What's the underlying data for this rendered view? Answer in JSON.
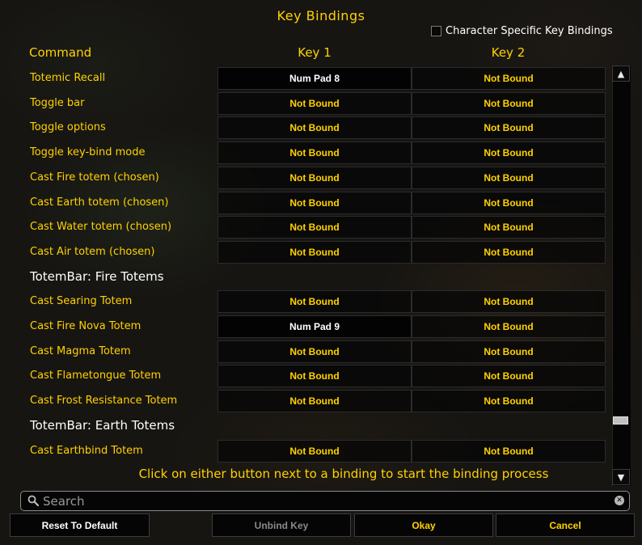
{
  "window": {
    "title": "Key Bindings",
    "character_specific_label": "Character Specific Key Bindings",
    "character_specific_checked": false
  },
  "columns": {
    "command": "Command",
    "key1": "Key 1",
    "key2": "Key 2"
  },
  "rows": [
    {
      "kind": "binding",
      "command": "Totemic Recall",
      "key1": "Num Pad 8",
      "key2": "Not Bound"
    },
    {
      "kind": "binding",
      "command": "Toggle bar",
      "key1": "Not Bound",
      "key2": "Not Bound"
    },
    {
      "kind": "binding",
      "command": "Toggle options",
      "key1": "Not Bound",
      "key2": "Not Bound"
    },
    {
      "kind": "binding",
      "command": "Toggle key-bind mode",
      "key1": "Not Bound",
      "key2": "Not Bound"
    },
    {
      "kind": "binding",
      "command": "Cast Fire totem (chosen)",
      "key1": "Not Bound",
      "key2": "Not Bound"
    },
    {
      "kind": "binding",
      "command": "Cast Earth totem (chosen)",
      "key1": "Not Bound",
      "key2": "Not Bound"
    },
    {
      "kind": "binding",
      "command": "Cast Water totem (chosen)",
      "key1": "Not Bound",
      "key2": "Not Bound"
    },
    {
      "kind": "binding",
      "command": "Cast Air totem (chosen)",
      "key1": "Not Bound",
      "key2": "Not Bound"
    },
    {
      "kind": "section",
      "command": "TotemBar: Fire Totems"
    },
    {
      "kind": "binding",
      "command": "Cast Searing Totem",
      "key1": "Not Bound",
      "key2": "Not Bound"
    },
    {
      "kind": "binding",
      "command": "Cast Fire Nova Totem",
      "key1": "Num Pad 9",
      "key2": "Not Bound"
    },
    {
      "kind": "binding",
      "command": "Cast Magma Totem",
      "key1": "Not Bound",
      "key2": "Not Bound"
    },
    {
      "kind": "binding",
      "command": "Cast Flametongue Totem",
      "key1": "Not Bound",
      "key2": "Not Bound"
    },
    {
      "kind": "binding",
      "command": "Cast Frost Resistance Totem",
      "key1": "Not Bound",
      "key2": "Not Bound"
    },
    {
      "kind": "section",
      "command": "TotemBar: Earth Totems"
    },
    {
      "kind": "binding",
      "command": "Cast Earthbind Totem",
      "key1": "Not Bound",
      "key2": "Not Bound"
    }
  ],
  "hint": "Click on either button next to a binding to start the binding process",
  "search": {
    "placeholder": "Search",
    "value": ""
  },
  "buttons": {
    "reset": "Reset To Default",
    "unbind": "Unbind Key",
    "okay": "Okay",
    "cancel": "Cancel"
  },
  "colors": {
    "gold_text": "#ffd200",
    "white_text": "#ffffff",
    "disabled_text": "#8a8a8a"
  },
  "icons": {
    "search": "search-icon",
    "clear": "clear-icon",
    "scroll_up": "arrow-up-icon",
    "scroll_down": "arrow-down-icon"
  }
}
